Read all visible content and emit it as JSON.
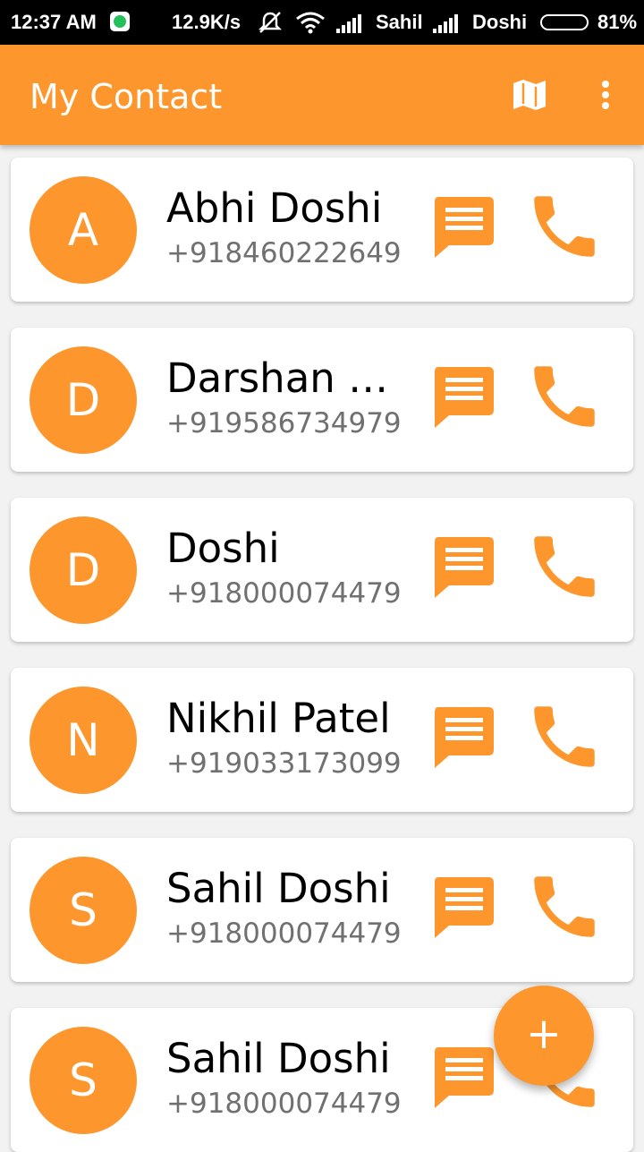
{
  "status_bar": {
    "time": "12:37 AM",
    "speed": "12.9K/s",
    "carrier1": "Sahil",
    "carrier2": "Doshi",
    "battery": "81%",
    "battery_level": 0.81
  },
  "app_bar": {
    "title": "My Contact",
    "map_icon": "map-icon",
    "menu_icon": "more-vert-icon"
  },
  "colors": {
    "accent": "#fd972d",
    "status_bar": "#000000",
    "background": "#f2f2f2",
    "phone_text": "#707070"
  },
  "contacts": [
    {
      "initial": "A",
      "name": "Abhi Doshi",
      "phone": "+918460222649"
    },
    {
      "initial": "D",
      "name": "Darshan D...",
      "phone": "+919586734979"
    },
    {
      "initial": "D",
      "name": "Doshi",
      "phone": "+918000074479"
    },
    {
      "initial": "N",
      "name": "Nikhil Patel",
      "phone": "+919033173099"
    },
    {
      "initial": "S",
      "name": "Sahil Doshi",
      "phone": "+918000074479"
    },
    {
      "initial": "S",
      "name": "Sahil Doshi",
      "phone": "+918000074479"
    }
  ],
  "fab": {
    "label": "+",
    "icon": "add-icon"
  }
}
